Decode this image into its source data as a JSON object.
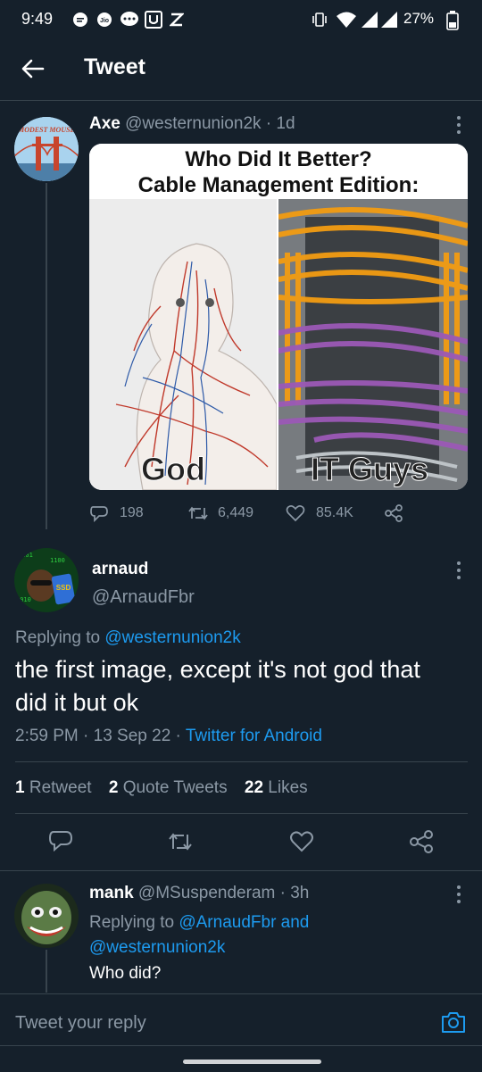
{
  "status_bar": {
    "time": "9:49",
    "battery": "27%",
    "icons": [
      "chat-bubble-icon",
      "jio-icon",
      "message-icon",
      "u-app-icon",
      "z-app-icon",
      "vibrate-icon",
      "wifi-icon",
      "signal-icon",
      "signal-icon",
      "battery-icon"
    ]
  },
  "header": {
    "title": "Tweet"
  },
  "parent_tweet": {
    "name": "Axe",
    "handle": "@westernunion2k",
    "time": "· 1d",
    "avatar_text": "MODEST MOUSE",
    "image": {
      "title_line1": "Who Did It Better?",
      "title_line2": "Cable Management Edition:",
      "left_caption": "God",
      "right_caption": "IT Guys"
    },
    "replies": "198",
    "retweets": "6,449",
    "likes": "85.4K"
  },
  "main_tweet": {
    "name": "arnaud",
    "handle": "@ArnaudFbr",
    "replying_prefix": "Replying to",
    "replying_handle": "@westernunion2k",
    "text": "the first image, except it's not god that did it but ok",
    "timestamp": "2:59 PM · 13 Sep 22 · ",
    "source": "Twitter for Android",
    "stats": {
      "retweets_count": "1",
      "retweets_label": "Retweet",
      "quotes_count": "2",
      "quotes_label": "Quote Tweets",
      "likes_count": "22",
      "likes_label": "Likes"
    }
  },
  "reply_tweet": {
    "name": "mank",
    "handle": "@MSuspenderam",
    "time": "· 3h",
    "replying_prefix": "Replying to",
    "replying_line1": "@ArnaudFbr and",
    "replying_line2": "@westernunion2k",
    "text": "Who did?"
  },
  "composer": {
    "placeholder": "Tweet your reply"
  },
  "colors": {
    "background": "#15202b",
    "accent": "#1d9bf0",
    "muted": "#8b98a5",
    "divider": "#38444d"
  }
}
